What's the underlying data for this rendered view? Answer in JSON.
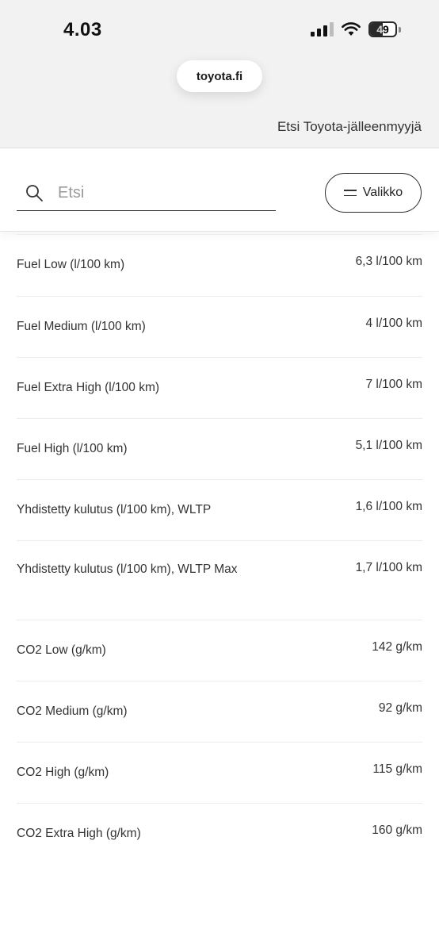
{
  "status_bar": {
    "time": "4.03",
    "battery": "49",
    "battery_level": 0.49
  },
  "browser": {
    "url": "toyota.fi"
  },
  "header": {
    "dealer_link": "Etsi Toyota-jälleenmyyjä",
    "search_placeholder": "Etsi",
    "menu_label": "Valikko"
  },
  "specs": [
    {
      "label": "Fuel Low (l/100 km)",
      "value": "6,3 l/100 km"
    },
    {
      "label": "Fuel Medium (l/100 km)",
      "value": "4 l/100 km"
    },
    {
      "label": "Fuel Extra High (l/100 km)",
      "value": "7 l/100 km"
    },
    {
      "label": "Fuel High (l/100 km)",
      "value": "5,1 l/100 km"
    },
    {
      "label": "Yhdistetty kulutus (l/100 km), WLTP",
      "value": "1,6 l/100 km"
    },
    {
      "label": "Yhdistetty kulutus (l/100 km), WLTP Max",
      "value": "1,7 l/100 km"
    },
    {
      "label": "CO2 Low (g/km)",
      "value": "142 g/km"
    },
    {
      "label": "CO2 Medium (g/km)",
      "value": "92 g/km"
    },
    {
      "label": "CO2 High (g/km)",
      "value": "115 g/km"
    },
    {
      "label": "CO2 Extra High (g/km)",
      "value": "160 g/km"
    }
  ]
}
